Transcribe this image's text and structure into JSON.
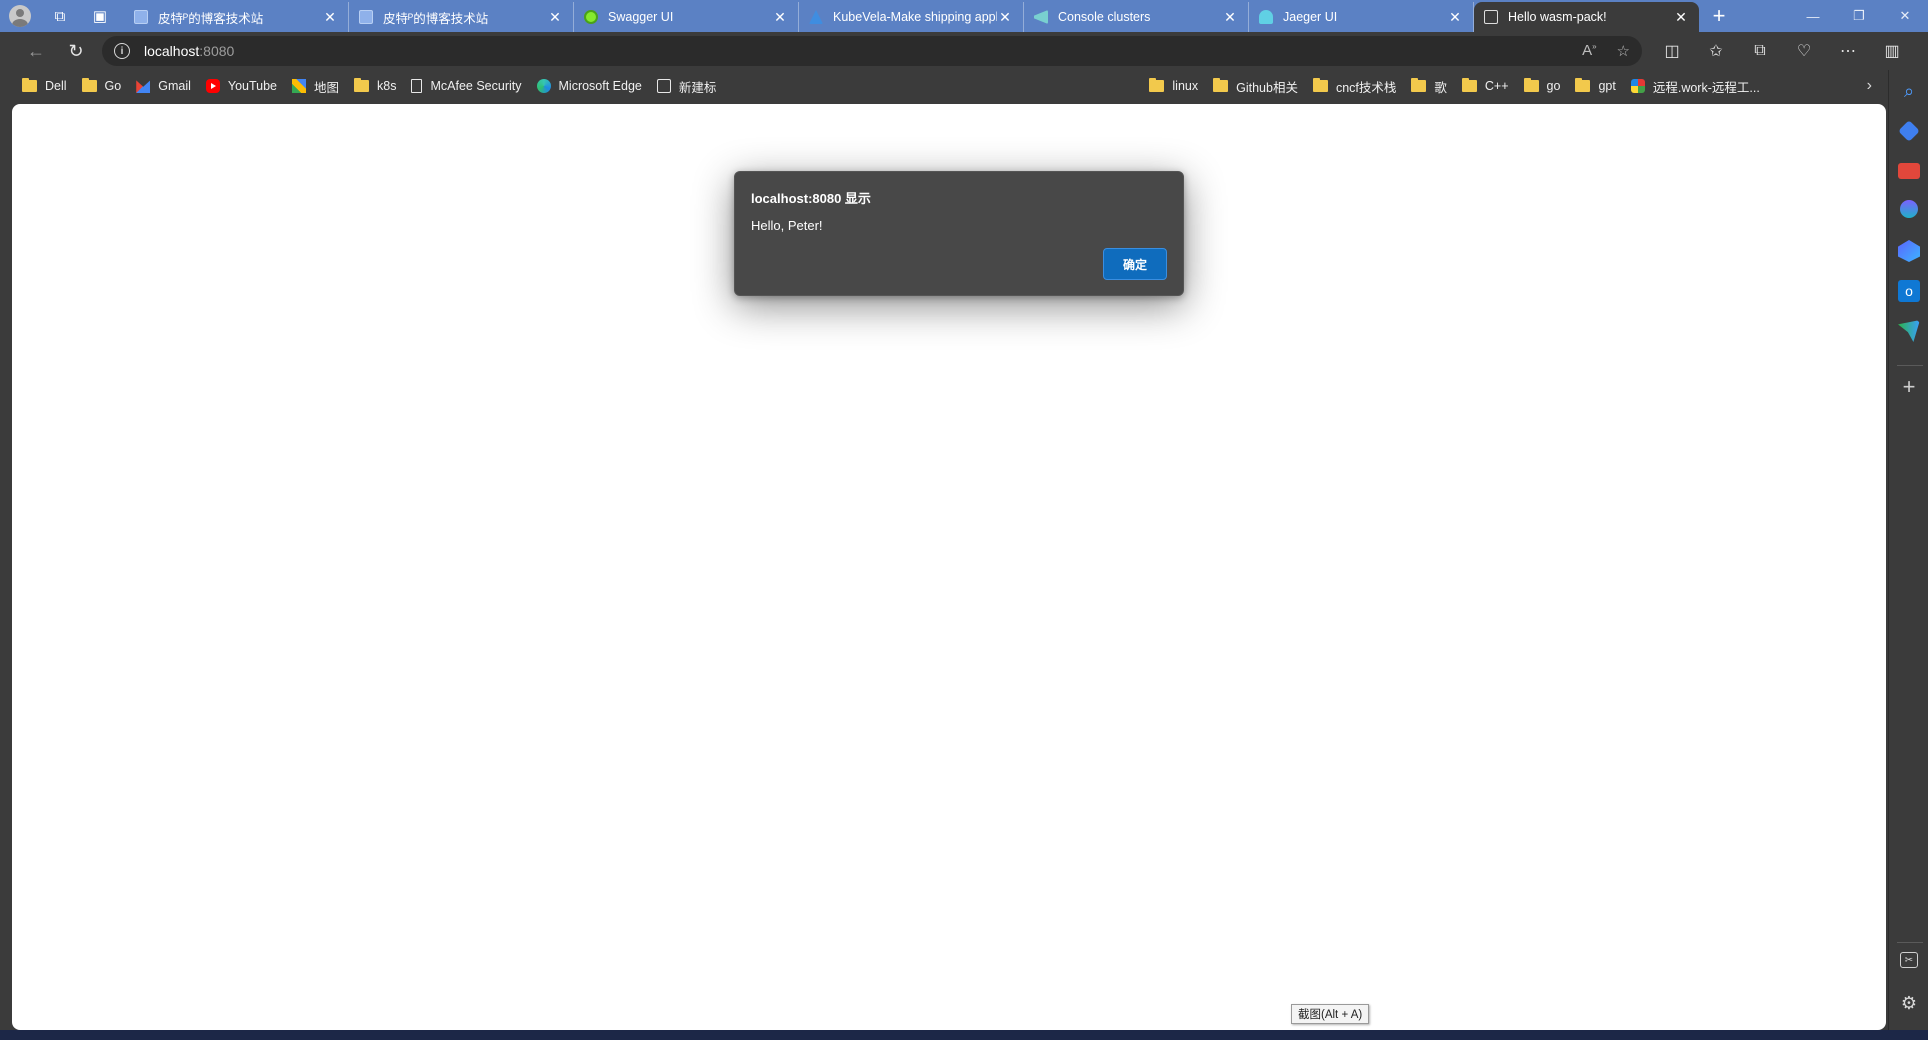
{
  "tabs": [
    {
      "title": "皮特ᴾ的博客技术站",
      "favicon": "blog-icon",
      "active": false
    },
    {
      "title": "皮特ᴾ的博客技术站",
      "favicon": "blog-icon",
      "active": false
    },
    {
      "title": "Swagger UI",
      "favicon": "swagger-icon",
      "active": false
    },
    {
      "title": "KubeVela-Make shipping applications more enjoyable",
      "favicon": "kubevela-icon",
      "active": false
    },
    {
      "title": "Console clusters",
      "favicon": "console-icon",
      "active": false
    },
    {
      "title": "Jaeger UI",
      "favicon": "jaeger-icon",
      "active": false
    },
    {
      "title": "Hello wasm-pack!",
      "favicon": "document-icon",
      "active": true
    }
  ],
  "address_bar": {
    "host": "localhost",
    "port": ":8080"
  },
  "bookmarks": [
    {
      "label": "Dell",
      "icon": "folder-icon"
    },
    {
      "label": "Go",
      "icon": "folder-icon"
    },
    {
      "label": "Gmail",
      "icon": "gmail-icon"
    },
    {
      "label": "YouTube",
      "icon": "youtube-icon"
    },
    {
      "label": "地图",
      "icon": "maps-icon"
    },
    {
      "label": "k8s",
      "icon": "folder-icon"
    },
    {
      "label": "McAfee Security",
      "icon": "document-icon"
    },
    {
      "label": "Microsoft Edge",
      "icon": "edge-icon"
    },
    {
      "label": "新建标",
      "icon": "calendar-icon"
    }
  ],
  "bookmarks_right": [
    {
      "label": "linux",
      "icon": "folder-icon"
    },
    {
      "label": "Github相关",
      "icon": "folder-icon"
    },
    {
      "label": "cncf技术栈",
      "icon": "folder-icon"
    },
    {
      "label": "歌",
      "icon": "folder-icon"
    },
    {
      "label": "C++",
      "icon": "folder-icon"
    },
    {
      "label": "go",
      "icon": "folder-icon"
    },
    {
      "label": "gpt",
      "icon": "folder-icon"
    },
    {
      "label": "远程.work-远程工...",
      "icon": "remote-work-icon"
    }
  ],
  "dialog": {
    "title": "localhost:8080 显示",
    "message": "Hello, Peter!",
    "ok_label": "确定"
  },
  "tooltip": "截图(Alt + A)",
  "colors": {
    "tabstrip": "#5b81c4",
    "chrome": "#3b3b3b",
    "dialog_bg": "#484848",
    "ok_button": "#0f6cbd"
  }
}
